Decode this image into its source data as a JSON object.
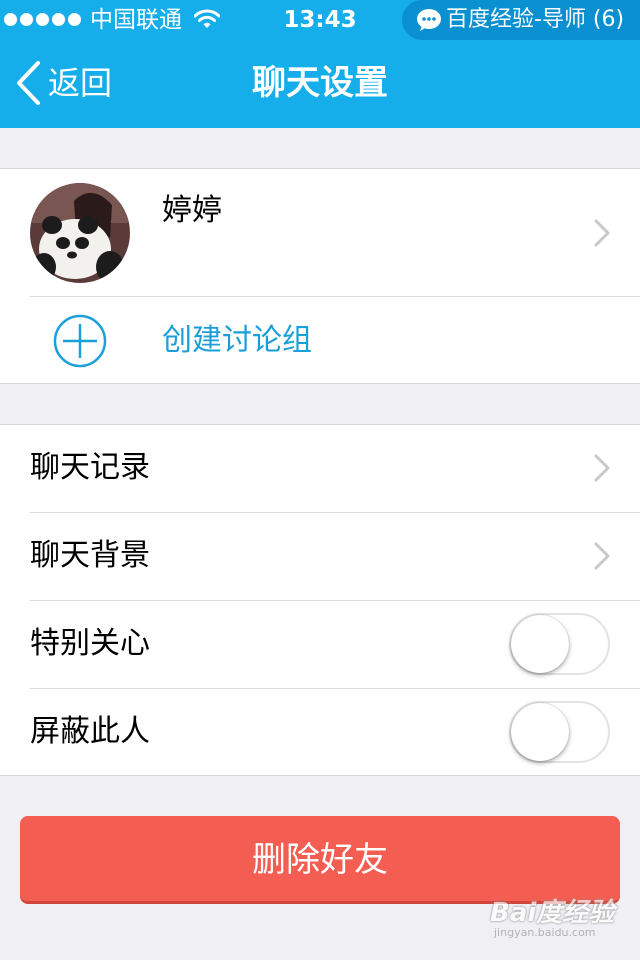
{
  "status_bar": {
    "carrier": "中国联通",
    "time": "13:43",
    "notification": "百度经验-导师 (6)"
  },
  "nav": {
    "back_label": "返回",
    "title": "聊天设置"
  },
  "profile": {
    "name": "婷婷",
    "create_group_label": "创建讨论组"
  },
  "settings": {
    "chat_history": "聊天记录",
    "chat_background": "聊天背景",
    "special_care": {
      "label": "特别关心",
      "on": false
    },
    "block_person": {
      "label": "屏蔽此人",
      "on": false
    }
  },
  "delete_button": "删除好友",
  "watermark": {
    "main": "Bai度经验",
    "sub": "jingyan.baidu.com"
  },
  "colors": {
    "header": "#15aeea",
    "accent_blue": "#1a9fd9",
    "delete_red": "#f45e52",
    "background": "#efeff4"
  }
}
